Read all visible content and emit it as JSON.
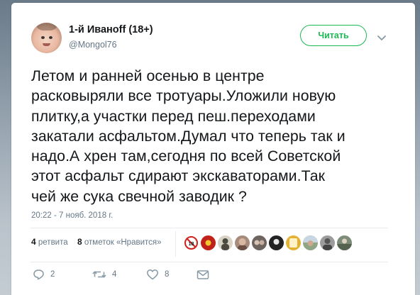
{
  "tweet": {
    "author": {
      "display_name": "1-й Иванoff (18+)",
      "handle": "@Mongol76"
    },
    "follow_button_label": "Читать",
    "text_lines": [
      "Летом и ранней осенью в центре",
      "расковыряли все тротуары.Уложили новую",
      "плитку,а участки перед пеш.переходами",
      "закатали асфальтом.Думал что теперь так и",
      "надо.А хрен там,сегодня по всей Советской",
      "этот асфальт сдирают экскаваторами.Так",
      "чей же сука свечной заводик ?"
    ],
    "timestamp": "20:22 - 7 нояб. 2018 г.",
    "stats": {
      "retweets_count": "4",
      "retweets_label": "ретвита",
      "likes_count": "8",
      "likes_label": "отметок «Нравится»"
    },
    "liker_avatars": [
      {
        "icon": "no-entry-18-avatar",
        "color": "#ffffff"
      },
      {
        "icon": "red-emblem-avatar",
        "color": "#c0221a"
      },
      {
        "icon": "dark-figure-avatar",
        "color": "#4c4a3e"
      },
      {
        "icon": "person-avatar",
        "color": "#a58b7a"
      },
      {
        "icon": "group-avatar",
        "color": "#6d6460"
      },
      {
        "icon": "dark-avatar",
        "color": "#222222"
      },
      {
        "icon": "yellow-avatar",
        "color": "#e3b234"
      },
      {
        "icon": "landscape-avatar",
        "color": "#8fa585"
      },
      {
        "icon": "portrait-avatar",
        "color": "#9c9c9c"
      },
      {
        "icon": "outdoor-avatar",
        "color": "#7d8c79"
      }
    ],
    "actions": {
      "reply_count": "2",
      "retweet_count": "4",
      "like_count": "8"
    }
  },
  "colors": {
    "accent_green": "#1dba54",
    "text_primary": "#14171a",
    "text_secondary": "#657786",
    "border": "#e6ecf0"
  }
}
